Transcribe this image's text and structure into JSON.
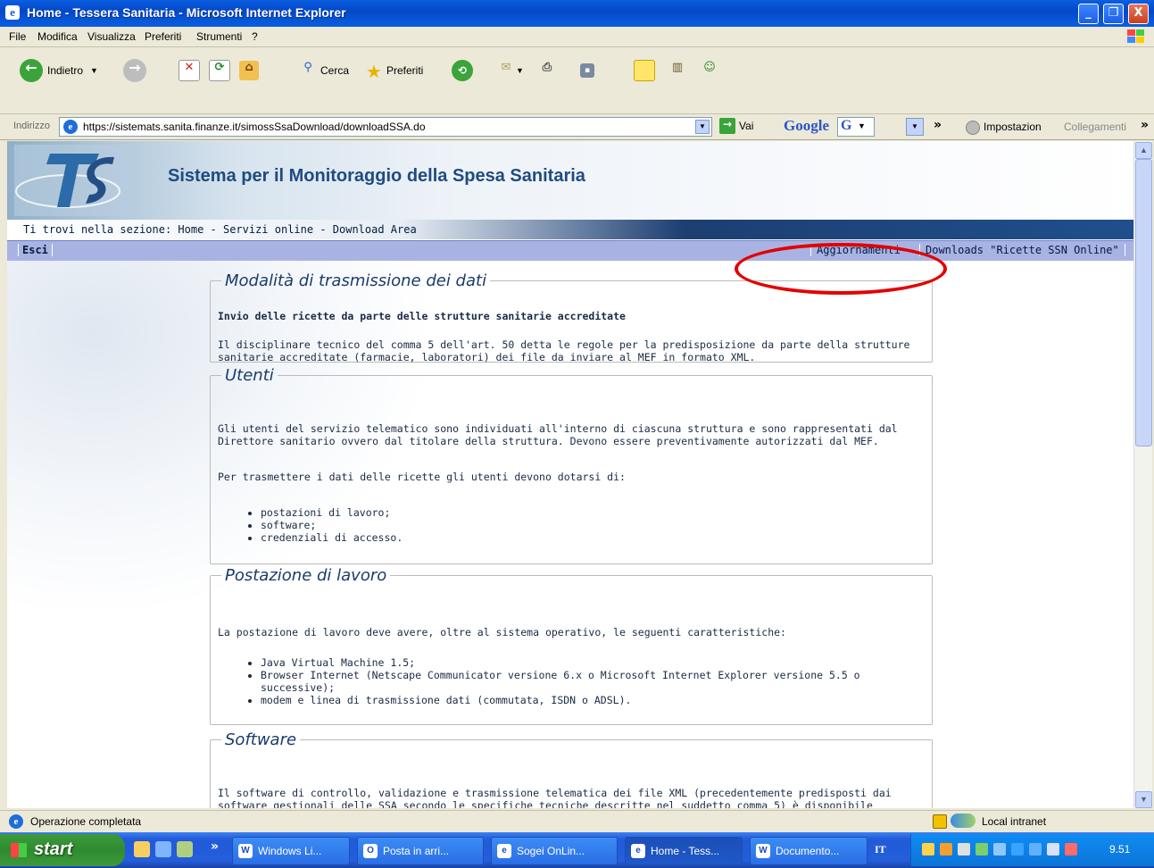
{
  "window": {
    "title": "Home - Tessera Sanitaria - Microsoft Internet Explorer",
    "min": "_",
    "max": "❐",
    "close": "X"
  },
  "menu": [
    "File",
    "Modifica",
    "Visualizza",
    "Preferiti",
    "Strumenti",
    "?"
  ],
  "toolbar": {
    "back_label": "Indietro",
    "search_label": "Cerca",
    "favorites_label": "Preferiti"
  },
  "address": {
    "label": "Indirizzo",
    "url": "https://sistemats.sanita.finanze.it/simossSsaDownload/downloadSSA.do",
    "go_label": "Vai",
    "google_label": "Google",
    "google_g": "G",
    "settings_label": "Impostazion",
    "links_label": "Collegamenti",
    "more": "»"
  },
  "page": {
    "banner_title": "Sistema per il Monitoraggio della Spesa Sanitaria",
    "breadcrumb": "Ti trovi nella sezione: Home - Servizi online - Download Area",
    "nav_exit": "Esci",
    "nav_updates": "Aggiornamenti",
    "nav_downloads": "Downloads \"Ricette SSN Online\"",
    "sections": [
      {
        "title": "Modalità di trasmissione dei dati",
        "subtitle": "Invio delle ricette da parte delle strutture sanitarie accreditate",
        "text": "Il disciplinare tecnico del comma 5 dell'art. 50 detta le regole per la predisposizione da parte della strutture sanitarie accreditate (farmacie, laboratori) dei file da inviare al MEF in formato XML."
      },
      {
        "title": "Utenti",
        "text": "Gli utenti del servizio telematico sono individuati all'interno di ciascuna struttura e sono rappresentati dal Direttore sanitario ovvero dal titolare della struttura. Devono essere preventivamente autorizzati dal MEF.",
        "text2": "Per trasmettere i dati delle ricette gli utenti devono dotarsi di:",
        "items": [
          "postazioni di lavoro;",
          "software;",
          "credenziali di accesso."
        ]
      },
      {
        "title": "Postazione di lavoro",
        "text": "La postazione di lavoro deve avere, oltre al sistema operativo, le seguenti caratteristiche:",
        "items": [
          "Java Virtual Machine 1.5;",
          "Browser Internet (Netscape Communicator versione 6.x o Microsoft Internet Explorer versione 5.5 o successive);",
          "modem e linea di trasmissione dati (commutata, ISDN o ADSL)."
        ]
      },
      {
        "title": "Software",
        "text": "Il software di controllo, validazione e trasmissione telematica dei file XML (precedentemente predisposti dai software gestionali delle SSA secondo le specifiche tecniche descritte nel suddetto comma 5) è disponibile nell'area download del portale del Sistema TS riservata agli utenti accreditati."
      }
    ]
  },
  "status": {
    "text": "Operazione completata",
    "zone": "Local intranet"
  },
  "taskbar": {
    "start": "start",
    "more": "»",
    "tasks": [
      "Windows Li...",
      "Posta in arri...",
      "Sogei OnLin...",
      "Home - Tess...",
      "Documento..."
    ],
    "lang": "IT",
    "clock": "9.51"
  },
  "colors": {
    "titlebar": "#0a5fe0",
    "nav_bar": "#a9b3e3",
    "banner_text": "#1f4b80",
    "highlight_ring": "#e30000"
  }
}
